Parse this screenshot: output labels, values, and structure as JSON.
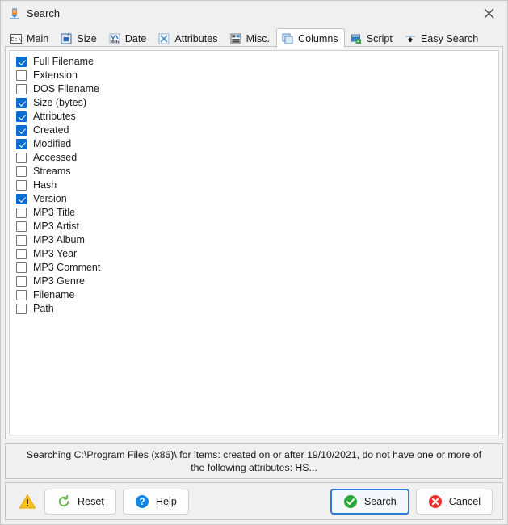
{
  "window": {
    "title": "Search",
    "icon": "search-tool-icon",
    "close_label": "×"
  },
  "tabs": [
    {
      "label": "Main",
      "icon": "console-icon",
      "active": false
    },
    {
      "label": "Size",
      "icon": "size-icon",
      "active": false
    },
    {
      "label": "Date",
      "icon": "date-chart-icon",
      "active": false
    },
    {
      "label": "Attributes",
      "icon": "attributes-icon",
      "active": false
    },
    {
      "label": "Misc.",
      "icon": "misc-icon",
      "active": false
    },
    {
      "label": "Columns",
      "icon": "columns-icon",
      "active": true
    },
    {
      "label": "Script",
      "icon": "script-icon",
      "active": false
    },
    {
      "label": "Easy Search",
      "icon": "easy-search-icon",
      "active": false
    }
  ],
  "columns": [
    {
      "label": "Full Filename",
      "checked": true
    },
    {
      "label": "Extension",
      "checked": false
    },
    {
      "label": "DOS Filename",
      "checked": false
    },
    {
      "label": "Size (bytes)",
      "checked": true
    },
    {
      "label": "Attributes",
      "checked": true
    },
    {
      "label": "Created",
      "checked": true
    },
    {
      "label": "Modified",
      "checked": true
    },
    {
      "label": "Accessed",
      "checked": false
    },
    {
      "label": "Streams",
      "checked": false
    },
    {
      "label": "Hash",
      "checked": false
    },
    {
      "label": "Version",
      "checked": true
    },
    {
      "label": "MP3 Title",
      "checked": false
    },
    {
      "label": "MP3 Artist",
      "checked": false
    },
    {
      "label": "MP3 Album",
      "checked": false
    },
    {
      "label": "MP3 Year",
      "checked": false
    },
    {
      "label": "MP3 Comment",
      "checked": false
    },
    {
      "label": "MP3 Genre",
      "checked": false
    },
    {
      "label": "Filename",
      "checked": false
    },
    {
      "label": "Path",
      "checked": false
    }
  ],
  "status": {
    "line1": "Searching C:\\Program Files (x86)\\ for items: created on or after 19/10/2021, do not have one or more of",
    "line2": "the following attributes: HS..."
  },
  "buttons": {
    "warning_icon": "warning-triangle-icon",
    "reset": {
      "label_pre": "Rese",
      "accel": "t",
      "label_post": "",
      "icon": "refresh-icon"
    },
    "help": {
      "label_pre": "H",
      "accel": "e",
      "label_post": "lp",
      "icon": "question-icon"
    },
    "search": {
      "label_pre": "",
      "accel": "S",
      "label_post": "earch",
      "icon": "check-circle-icon"
    },
    "cancel": {
      "label_pre": "",
      "accel": "C",
      "label_post": "ancel",
      "icon": "cancel-circle-icon"
    }
  },
  "colors": {
    "accent_blue": "#0a6ed1",
    "default_border": "#2a7fd4",
    "warning_yellow": "#ffc21a",
    "success_green": "#2aa83c",
    "danger_red": "#e8302a",
    "help_blue": "#1287e8",
    "reset_green": "#62b74a"
  }
}
